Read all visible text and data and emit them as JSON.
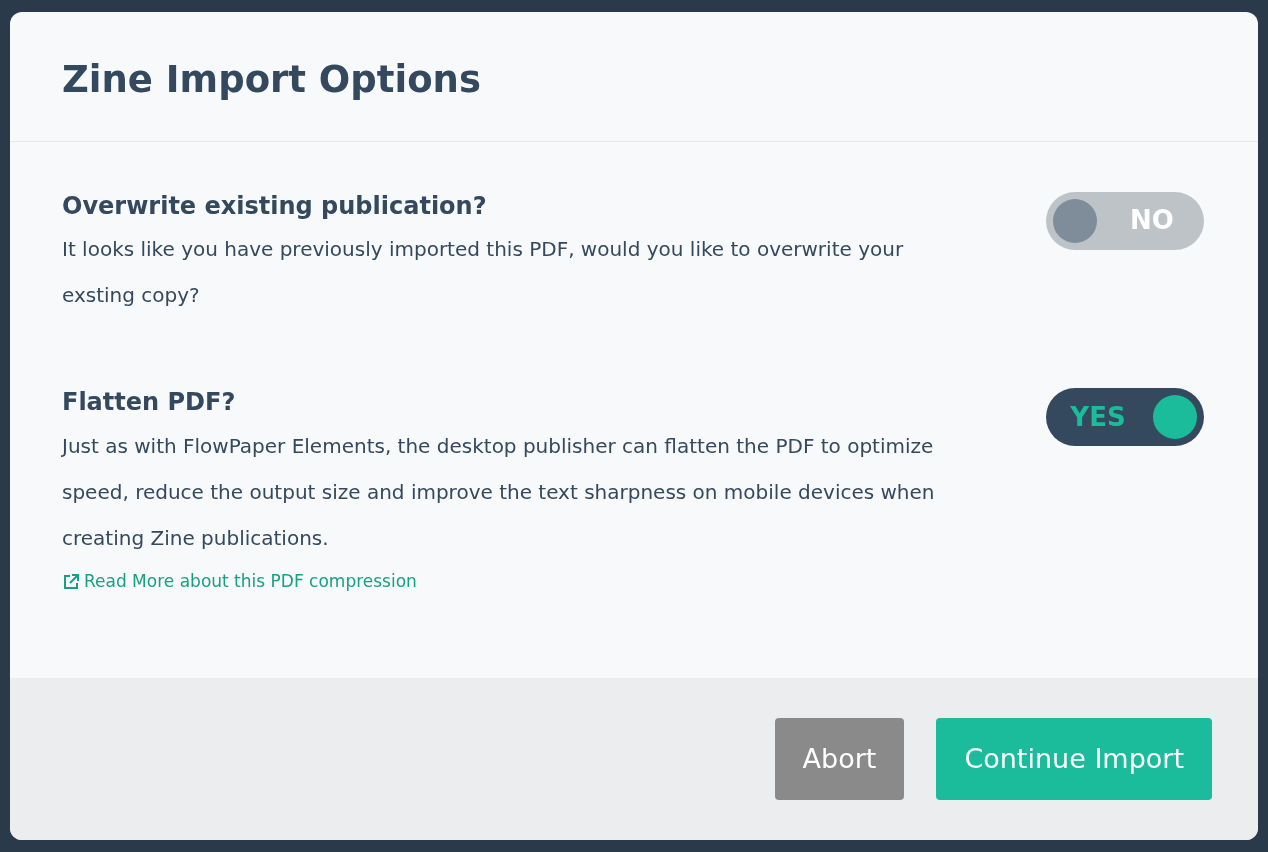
{
  "dialog": {
    "title": "Zine Import Options"
  },
  "options": [
    {
      "title": "Overwrite existing publication?",
      "description": "It looks like you have previously imported this PDF, would you like to overwrite your exsting copy?",
      "on": false,
      "toggle_label": "NO"
    },
    {
      "title": "Flatten PDF?",
      "description": "Just as with FlowPaper Elements, the desktop publisher can flatten the PDF to optimize speed, reduce the output size and improve the text sharpness on mobile devices when creating Zine publications.",
      "on": true,
      "toggle_label": "YES",
      "link": "Read More about this PDF compression"
    }
  ],
  "buttons": [
    {
      "label": "Abort",
      "kind": "secondary"
    },
    {
      "label": "Continue Import",
      "kind": "primary"
    }
  ]
}
